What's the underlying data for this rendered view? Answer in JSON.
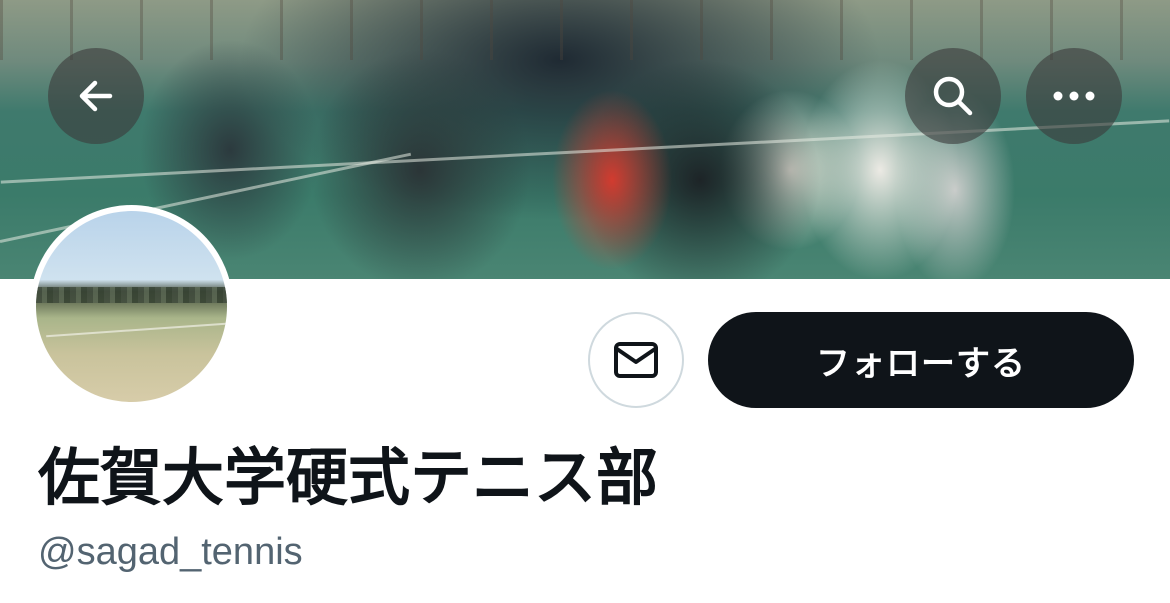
{
  "profile": {
    "display_name": "佐賀大学硬式テニス部",
    "handle": "@sagad_tennis"
  },
  "actions": {
    "follow_label": "フォローする"
  },
  "icons": {
    "back": "arrow-left-icon",
    "search": "search-icon",
    "more": "more-horizontal-icon",
    "message": "envelope-icon"
  },
  "colors": {
    "follow_button_bg": "#0f1419",
    "handle_text": "#536471",
    "overlay_button_bg": "rgba(60,60,60,0.62)"
  }
}
